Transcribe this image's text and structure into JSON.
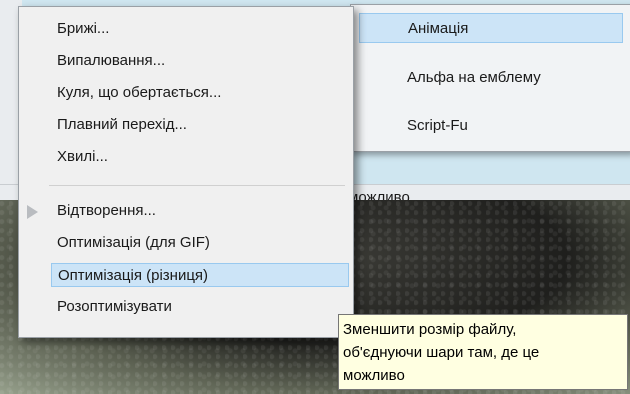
{
  "submenu": {
    "items": [
      {
        "label": "Анімація",
        "active": true
      },
      {
        "label": "Альфа на емблему",
        "active": false
      },
      {
        "label": "Script-Fu",
        "active": false
      }
    ]
  },
  "menu": {
    "items": [
      {
        "label": "Брижі..."
      },
      {
        "label": "Випалювання..."
      },
      {
        "label": "Куля, що обертається..."
      },
      {
        "label": "Плавний перехід..."
      },
      {
        "label": "Хвилі..."
      },
      {
        "label": "Відтворення..."
      },
      {
        "label": "Оптимізація (для GIF)"
      },
      {
        "label": "Оптимізація (різниця)",
        "highlighted": true
      },
      {
        "label": "Розоптимізувати"
      }
    ]
  },
  "status_strip": {
    "text": "можливо"
  },
  "tooltip": {
    "lines": [
      "Зменшити розмір файлу,",
      "об'єднуючи шари там, де це",
      "можливо"
    ]
  },
  "icons": {
    "play": "play-triangle-icon"
  },
  "colors": {
    "highlight": "#cce4f7",
    "tooltip_bg": "#ffffe1"
  }
}
